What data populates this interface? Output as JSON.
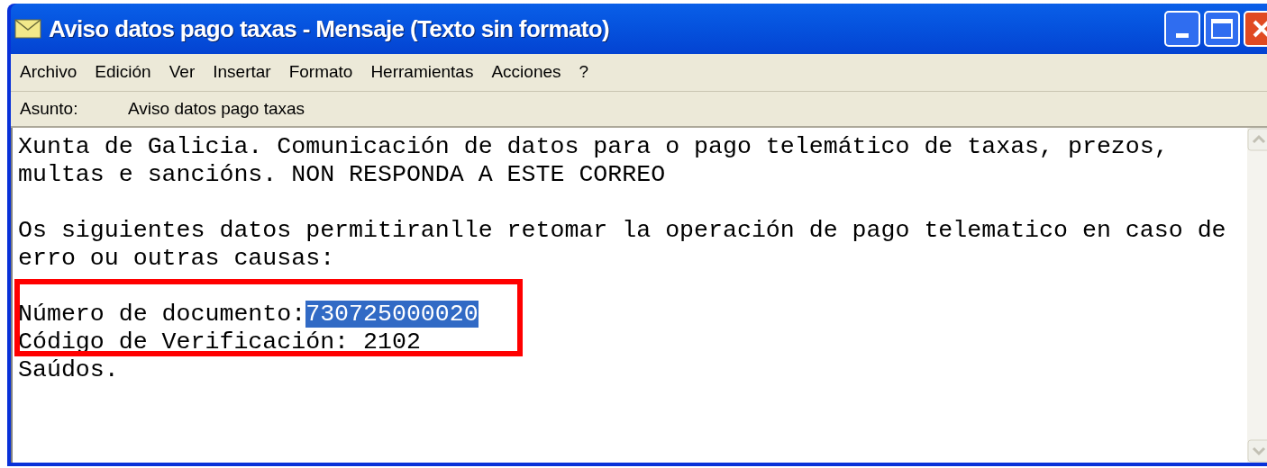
{
  "window": {
    "title": "Aviso datos pago taxas - Mensaje (Texto sin formato)"
  },
  "menu": [
    "Archivo",
    "Edición",
    "Ver",
    "Insertar",
    "Formato",
    "Herramientas",
    "Acciones",
    "?"
  ],
  "subject": {
    "label": "Asunto:",
    "value": "Aviso datos pago taxas"
  },
  "body": {
    "lines": [
      {
        "kind": "text",
        "text": "Xunta de Galicia. Comunicación de datos para o pago telemático de taxas, prezos,"
      },
      {
        "kind": "text",
        "text": "multas e sancións. NON RESPONDA A ESTE CORREO"
      },
      {
        "kind": "blank"
      },
      {
        "kind": "text",
        "text": "Os siguientes datos permitiranlle retomar la operación de pago telematico en caso de"
      },
      {
        "kind": "text",
        "text": "erro ou outras causas:"
      },
      {
        "kind": "blank"
      },
      {
        "kind": "field",
        "label": "Número de documento:",
        "value": "730725000020",
        "selected": true
      },
      {
        "kind": "text",
        "text": "Código de Verificación: 2102"
      },
      {
        "kind": "text",
        "text": "Saúdos."
      }
    ]
  }
}
